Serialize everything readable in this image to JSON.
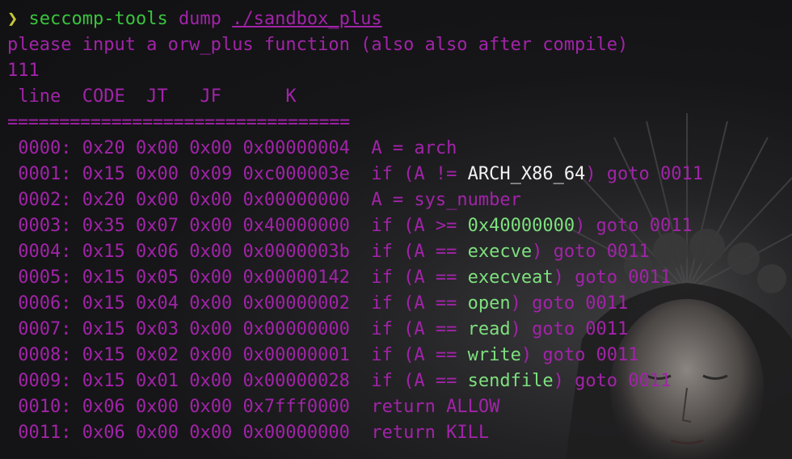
{
  "terminal": {
    "prompt_symbol": "❯",
    "command": "seccomp-tools",
    "command_args": "dump",
    "command_path": "./sandbox_plus",
    "message": "please input a orw_plus function (also also after compile)",
    "input_echo": "111",
    "table_header": " line  CODE  JT   JF      K",
    "separator": "=================================",
    "rows": [
      {
        "addr": " 0000:",
        "code": "0x20",
        "jt": "0x00",
        "jf": "0x00",
        "k": "0x00000004",
        "pre": "A = arch",
        "hl": "",
        "post": ""
      },
      {
        "addr": " 0001:",
        "code": "0x15",
        "jt": "0x00",
        "jf": "0x09",
        "k": "0xc000003e",
        "pre": "if (A != ",
        "hl": "ARCH_X86_64",
        "post": ") goto 0011"
      },
      {
        "addr": " 0002:",
        "code": "0x20",
        "jt": "0x00",
        "jf": "0x00",
        "k": "0x00000000",
        "pre": "A = sys_number",
        "hl": "",
        "post": ""
      },
      {
        "addr": " 0003:",
        "code": "0x35",
        "jt": "0x07",
        "jf": "0x00",
        "k": "0x40000000",
        "pre": "if (A >= ",
        "hl": "0x40000000",
        "post": ") goto 0011"
      },
      {
        "addr": " 0004:",
        "code": "0x15",
        "jt": "0x06",
        "jf": "0x00",
        "k": "0x0000003b",
        "pre": "if (A == ",
        "hl": "execve",
        "post": ") goto 0011"
      },
      {
        "addr": " 0005:",
        "code": "0x15",
        "jt": "0x05",
        "jf": "0x00",
        "k": "0x00000142",
        "pre": "if (A == ",
        "hl": "execveat",
        "post": ") goto 0011"
      },
      {
        "addr": " 0006:",
        "code": "0x15",
        "jt": "0x04",
        "jf": "0x00",
        "k": "0x00000002",
        "pre": "if (A == ",
        "hl": "open",
        "post": ") goto 0011"
      },
      {
        "addr": " 0007:",
        "code": "0x15",
        "jt": "0x03",
        "jf": "0x00",
        "k": "0x00000000",
        "pre": "if (A == ",
        "hl": "read",
        "post": ") goto 0011"
      },
      {
        "addr": " 0008:",
        "code": "0x15",
        "jt": "0x02",
        "jf": "0x00",
        "k": "0x00000001",
        "pre": "if (A == ",
        "hl": "write",
        "post": ") goto 0011"
      },
      {
        "addr": " 0009:",
        "code": "0x15",
        "jt": "0x01",
        "jf": "0x00",
        "k": "0x00000028",
        "pre": "if (A == ",
        "hl": "sendfile",
        "post": ") goto 0011"
      },
      {
        "addr": " 0010:",
        "code": "0x06",
        "jt": "0x00",
        "jf": "0x00",
        "k": "0x7fff0000",
        "pre": "return ALLOW",
        "hl": "",
        "post": ""
      },
      {
        "addr": " 0011:",
        "code": "0x06",
        "jt": "0x00",
        "jf": "0x00",
        "k": "0x00000000",
        "pre": "return KILL",
        "hl": "",
        "post": ""
      }
    ],
    "highlight_colors": {
      "0001": "white",
      "default": "green"
    },
    "colors": {
      "text": "#a223a9",
      "command": "#3ac33d",
      "prompt": "#c6c63a",
      "highlight_white": "#f2f2f2",
      "highlight_green": "#7ee07e",
      "background": "#141416"
    }
  }
}
